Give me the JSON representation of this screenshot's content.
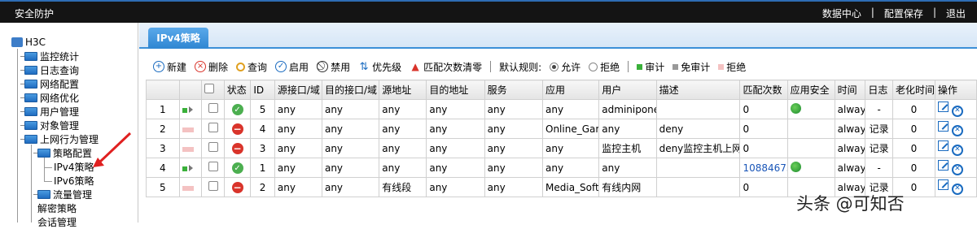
{
  "header": {
    "title": "安全防护",
    "links": [
      "数据中心",
      "|",
      "配置保存",
      "|",
      "退出"
    ]
  },
  "sidebar": {
    "root": "H3C",
    "items": [
      {
        "label": "监控统计"
      },
      {
        "label": "日志查询"
      },
      {
        "label": "网络配置"
      },
      {
        "label": "网络优化"
      },
      {
        "label": "用户管理"
      },
      {
        "label": "对象管理"
      },
      {
        "label": "上网行为管理"
      },
      {
        "label": "策略配置"
      },
      {
        "label": "IPv4策略"
      },
      {
        "label": "IPv6策略"
      },
      {
        "label": "流量管理"
      },
      {
        "label": "解密策略"
      },
      {
        "label": "会话管理"
      }
    ]
  },
  "tab": {
    "label": "IPv4策略"
  },
  "toolbar": {
    "new": "新建",
    "delete": "删除",
    "query": "查询",
    "enable": "启用",
    "disable": "禁用",
    "priority": "优先级",
    "clear_hits": "匹配次数清零",
    "default_rule": "默认规则:",
    "allow": "允许",
    "deny": "拒绝",
    "audit": "审计",
    "no_audit": "免审计",
    "reject": "拒绝"
  },
  "table": {
    "headers": [
      "",
      "",
      "",
      "状态",
      "ID",
      "源接口/域",
      "目的接口/域",
      "源地址",
      "目的地址",
      "服务",
      "应用",
      "用户",
      "描述",
      "匹配次数",
      "应用安全",
      "时间",
      "日志",
      "老化时间",
      "操作"
    ],
    "rows": [
      {
        "num": "1",
        "prio": "green",
        "status": "ok",
        "id": "5",
        "src_if": "any",
        "dst_if": "any",
        "src_addr": "any",
        "dst_addr": "any",
        "service": "any",
        "app": "any",
        "user": "adminipone",
        "desc": "",
        "hits": "0",
        "app_sec": true,
        "time": "always",
        "log": "-",
        "aging": "0"
      },
      {
        "num": "2",
        "prio": "pink",
        "status": "no",
        "id": "4",
        "src_if": "any",
        "dst_if": "any",
        "src_addr": "any",
        "dst_addr": "any",
        "service": "any",
        "app": "Online_Game",
        "user": "any",
        "desc": "deny",
        "hits": "0",
        "app_sec": false,
        "time": "always",
        "log": "记录",
        "aging": "0"
      },
      {
        "num": "3",
        "prio": "pink",
        "status": "no",
        "id": "3",
        "src_if": "any",
        "dst_if": "any",
        "src_addr": "any",
        "dst_addr": "any",
        "service": "any",
        "app": "any",
        "user": "监控主机",
        "desc": "deny监控主机上网",
        "hits": "0",
        "app_sec": false,
        "time": "always",
        "log": "记录",
        "aging": "0"
      },
      {
        "num": "4",
        "prio": "green",
        "status": "ok",
        "id": "1",
        "src_if": "any",
        "dst_if": "any",
        "src_addr": "any",
        "dst_addr": "any",
        "service": "any",
        "app": "any",
        "user": "any",
        "desc": "",
        "hits": "10884675",
        "app_sec": true,
        "time": "always",
        "log": "-",
        "aging": "0"
      },
      {
        "num": "5",
        "prio": "pink",
        "status": "no",
        "id": "2",
        "src_if": "any",
        "dst_if": "any",
        "src_addr": "有线段",
        "dst_addr": "any",
        "service": "any",
        "app": "Media_Software",
        "user": "有线内网",
        "desc": "",
        "hits": "0",
        "app_sec": false,
        "time": "always",
        "log": "记录",
        "aging": "0"
      }
    ]
  },
  "watermark": "头条 @可知否",
  "colors": {
    "accent": "#2f86d2",
    "ok": "#4caf50",
    "deny": "#d9342b"
  }
}
